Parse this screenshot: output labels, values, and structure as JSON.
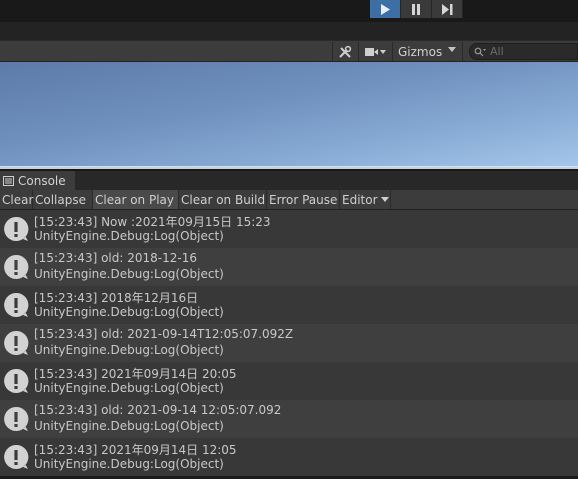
{
  "playbar": {
    "play_icon": "play-icon",
    "pause_icon": "pause-icon",
    "step_icon": "step-icon",
    "accent": "#3e6fa4"
  },
  "scene_toolbar": {
    "tools_icon": "tools-icon",
    "camera_icon": "camera-icon",
    "gizmos_label": "Gizmos",
    "search_placeholder": "All"
  },
  "console": {
    "tab_label": "Console",
    "tab_icon": "console-list-icon",
    "toolbar": {
      "clear": "Clear",
      "collapse": "Collapse",
      "clear_on_play": "Clear on Play",
      "clear_on_build": "Clear on Build",
      "error_pause": "Error Pause",
      "editor": "Editor"
    },
    "entries": [
      {
        "message": "[15:23:43] Now :2021年09月15日 15:23",
        "source": "UnityEngine.Debug:Log(Object)"
      },
      {
        "message": "[15:23:43] old: 2018-12-16",
        "source": "UnityEngine.Debug:Log(Object)"
      },
      {
        "message": "[15:23:43] 2018年12月16日",
        "source": "UnityEngine.Debug:Log(Object)"
      },
      {
        "message": "[15:23:43] old: 2021-09-14T12:05:07.092Z",
        "source": "UnityEngine.Debug:Log(Object)"
      },
      {
        "message": "[15:23:43] 2021年09月14日 20:05",
        "source": "UnityEngine.Debug:Log(Object)"
      },
      {
        "message": "[15:23:43] old: 2021-09-14 12:05:07.092",
        "source": "UnityEngine.Debug:Log(Object)"
      },
      {
        "message": "[15:23:43] 2021年09月14日 12:05",
        "source": "UnityEngine.Debug:Log(Object)"
      }
    ]
  }
}
